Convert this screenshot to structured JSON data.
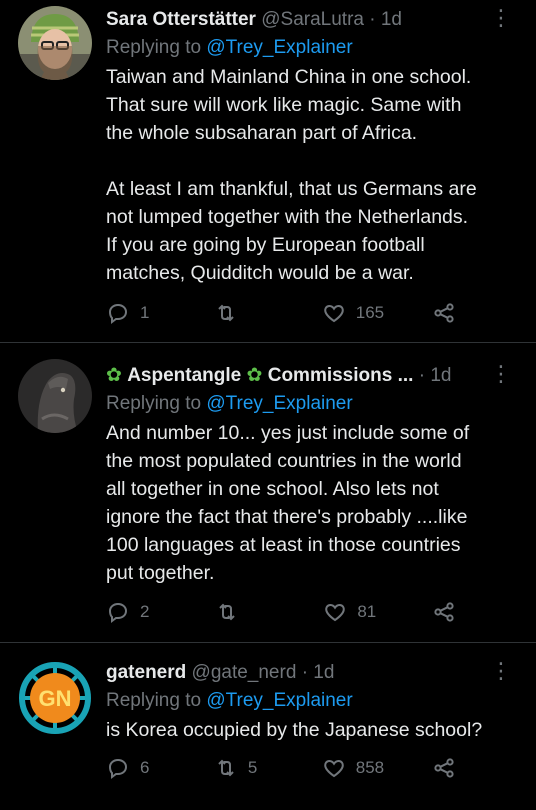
{
  "tweets": [
    {
      "name": "Sara Otterstätter",
      "handle": "@SaraLutra",
      "time": "1d",
      "replying_prefix": "Replying to",
      "replying_to": "@Trey_Explainer",
      "text": "Taiwan and Mainland China in one school.\nThat sure will work like magic. Same with\nthe whole subsaharan part of Africa.\n\nAt least I am thankful, that us Germans are\nnot lumped together with the Netherlands.\nIf you are going by European football\nmatches, Quidditch would be a war.",
      "replies": "1",
      "retweets": "",
      "likes": "165"
    },
    {
      "name": "Aspentangle",
      "name_suffix": "Commissions ...",
      "handle": "",
      "time": "1d",
      "replying_prefix": "Replying to",
      "replying_to": "@Trey_Explainer",
      "text": "And number 10... yes just include some of\nthe most populated countries in the world\nall together in one school. Also lets not\nignore the fact that there's probably ....like\n100 languages at least in those countries\nput together.",
      "replies": "2",
      "retweets": "",
      "likes": "81"
    },
    {
      "name": "gatenerd",
      "handle": "@gate_nerd",
      "time": "1d",
      "replying_prefix": "Replying to",
      "replying_to": "@Trey_Explainer",
      "text": "is Korea occupied by the Japanese school?",
      "replies": "6",
      "retweets": "5",
      "likes": "858",
      "avatar_text": "GN"
    }
  ],
  "colors": {
    "background": "#000000",
    "text": "#e7e9ea",
    "muted": "#71767b",
    "link": "#1d9bf0",
    "divider": "#2f3336"
  },
  "icons": {
    "more": "more-icon",
    "reply": "reply-icon",
    "retweet": "retweet-icon",
    "like": "heart-icon",
    "share": "share-icon",
    "leaf": "leaf-icon"
  }
}
